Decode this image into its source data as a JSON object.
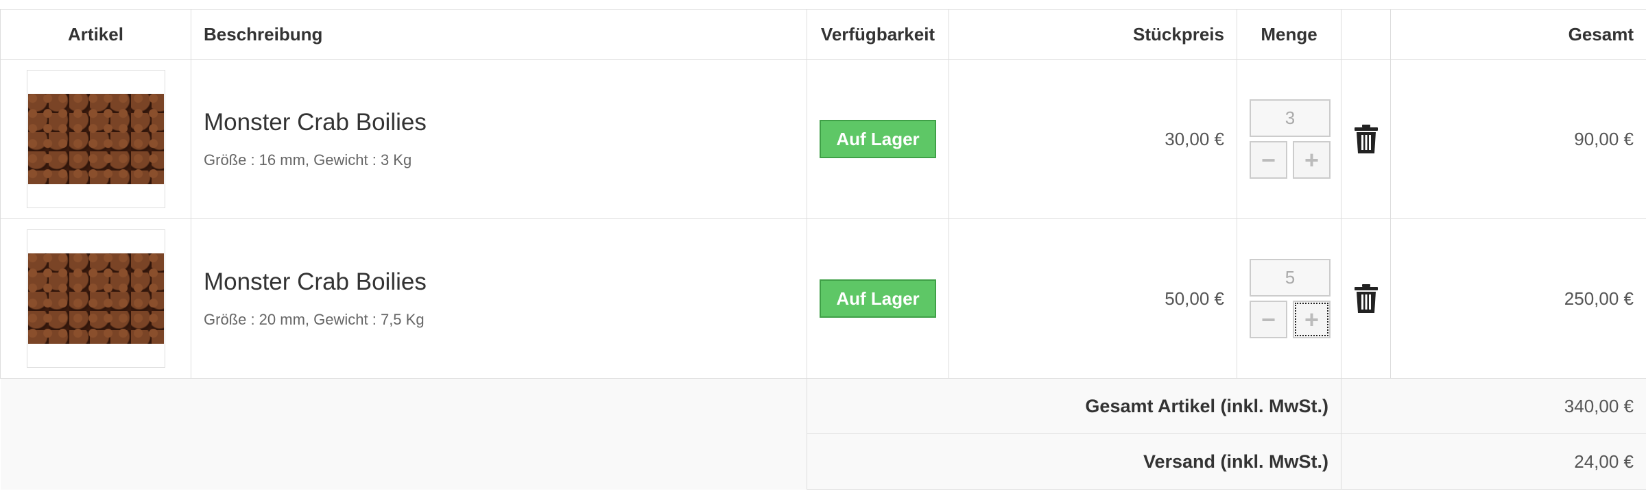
{
  "headers": {
    "artikel": "Artikel",
    "beschreibung": "Beschreibung",
    "verfuegbarkeit": "Verfügbarkeit",
    "stueckpreis": "Stückpreis",
    "menge": "Menge",
    "aktion": "",
    "gesamt": "Gesamt"
  },
  "items": [
    {
      "image": "boilies-thumbnail",
      "name": "Monster Crab Boilies",
      "variant": "Größe : 16 mm, Gewicht : 3 Kg",
      "availability": "Auf Lager",
      "unit_price": "30,00 €",
      "quantity": "3",
      "minus": "−",
      "plus": "+",
      "total": "90,00 €"
    },
    {
      "image": "boilies-thumbnail",
      "name": "Monster Crab Boilies",
      "variant": "Größe : 20 mm, Gewicht : 7,5 Kg",
      "availability": "Auf Lager",
      "unit_price": "50,00 €",
      "quantity": "5",
      "minus": "−",
      "plus": "+",
      "total": "250,00 €"
    }
  ],
  "summary": {
    "articles_label": "Gesamt Artikel (inkl. MwSt.)",
    "articles_value": "340,00 €",
    "shipping_label": "Versand (inkl. MwSt.)",
    "shipping_value": "24,00 €"
  },
  "colors": {
    "badge": "#5ec766",
    "border": "#dddddd",
    "footer_bg": "#f9f9f9"
  },
  "icons": {
    "delete": "trash-icon",
    "decrease": "minus-icon",
    "increase": "plus-icon"
  }
}
